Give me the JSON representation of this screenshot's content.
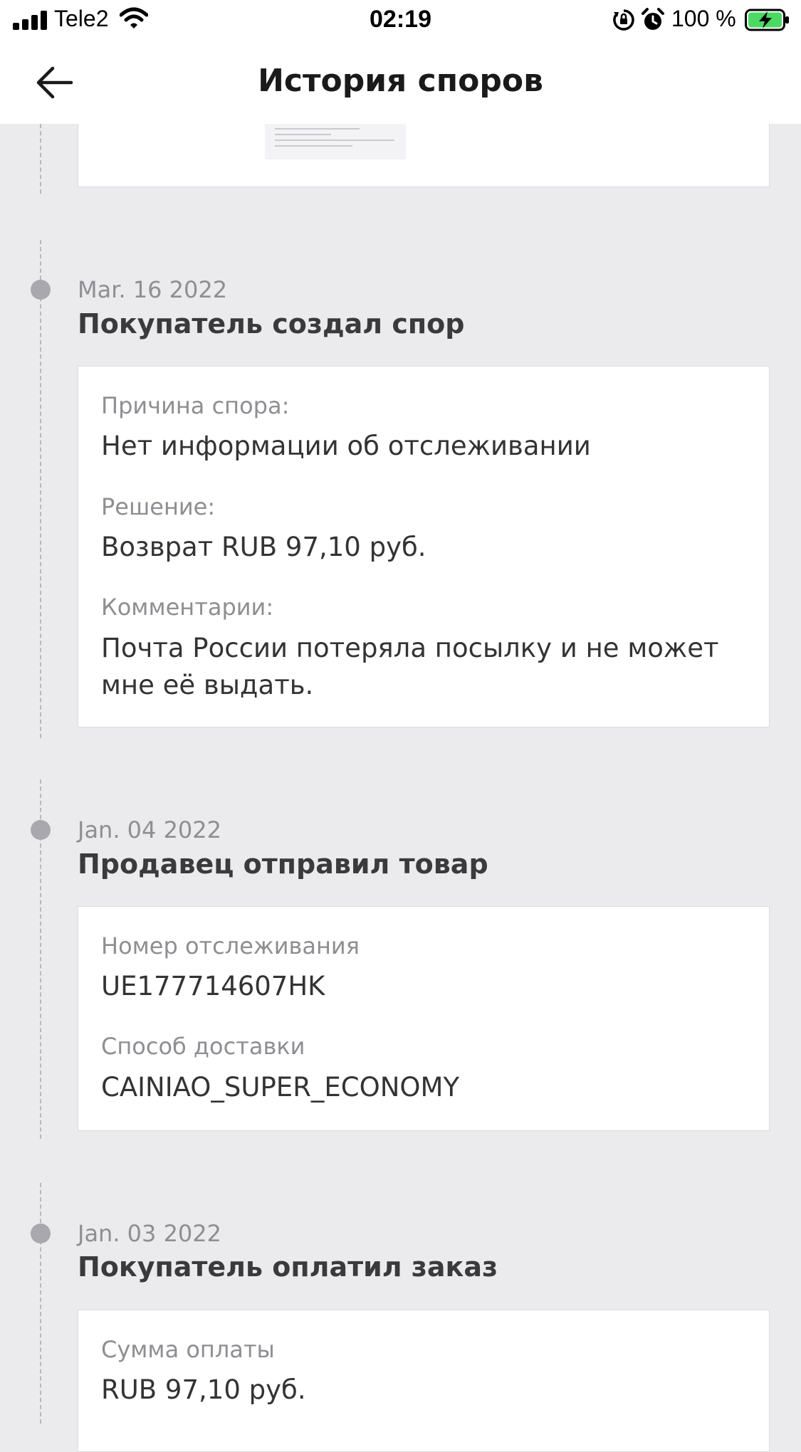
{
  "status_bar": {
    "carrier": "Tele2",
    "time": "02:19",
    "battery_percent": "100 %"
  },
  "header": {
    "title": "История споров"
  },
  "events": [
    {
      "date": "Mar. 16 2022",
      "title": "Покупатель создал спор",
      "fields": [
        {
          "label": "Причина спора:",
          "value": "Нет информации об отслеживании"
        },
        {
          "label": "Решение:",
          "value": "Возврат RUB 97,10 руб."
        },
        {
          "label": "Комментарии:",
          "value": "Почта России потеряла посылку и не может мне её выдать."
        }
      ]
    },
    {
      "date": "Jan. 04 2022",
      "title": "Продавец отправил товар",
      "fields": [
        {
          "label": "Номер отслеживания",
          "value": "UE177714607HK"
        },
        {
          "label": "Способ доставки",
          "value": "CAINIAO_SUPER_ECONOMY"
        }
      ]
    },
    {
      "date": "Jan. 03 2022",
      "title": "Покупатель оплатил заказ",
      "fields": [
        {
          "label": "Сумма оплаты",
          "value": "RUB 97,10 руб."
        }
      ]
    }
  ],
  "colors": {
    "background": "#ebebee",
    "card": "#ffffff",
    "timeline_dot": "#a9a9ad",
    "battery_green": "#4cd964"
  },
  "icons": {
    "back": "arrow-left-icon",
    "wifi": "wifi-icon",
    "orientation_lock": "orientation-lock-icon",
    "alarm": "alarm-icon",
    "battery": "battery-charging-icon"
  }
}
